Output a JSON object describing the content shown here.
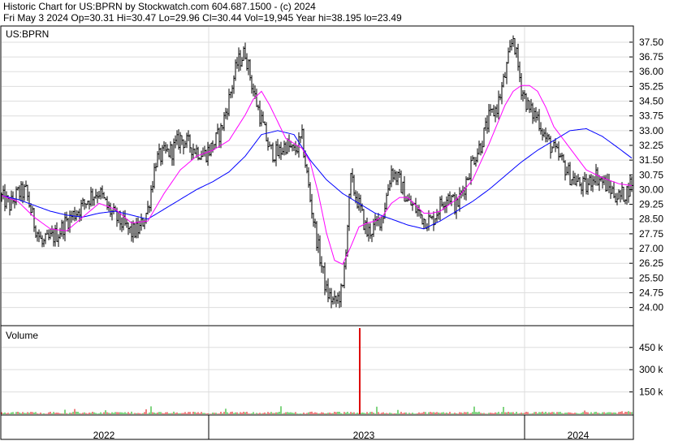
{
  "header": {
    "line1": "Historic Chart for US:BPRN by Stockwatch.com 604.687.1500 - (c) 2024",
    "line2": "Fri May  3 2024  Op=30.31  Hi=30.47  Lo=29.96  Cl=30.44  Vol=19,945  Year hi=38.195  lo=23.49"
  },
  "colors": {
    "price": "#000000",
    "ma_short": "#ff00ff",
    "ma_long": "#0000ff",
    "volume_up": "#00aa00",
    "volume_down": "#dd0000",
    "spike": "#dd0000"
  },
  "chart_data": [
    {
      "type": "line",
      "title": "US:BPRN",
      "xlabel": "",
      "ylabel": "",
      "x_ticks": [
        "2022",
        "2023",
        "2024"
      ],
      "ylim": [
        23.2,
        38.2
      ],
      "y_ticks": [
        "24.00",
        "24.75",
        "25.50",
        "26.25",
        "27.00",
        "27.75",
        "28.50",
        "29.25",
        "30.00",
        "30.75",
        "31.50",
        "32.25",
        "33.00",
        "33.75",
        "34.50",
        "35.25",
        "36.00",
        "36.75",
        "37.50"
      ],
      "grid": true,
      "series": [
        {
          "role": "price",
          "x": [
            0,
            10,
            20,
            30,
            40,
            50,
            60,
            70,
            80,
            90,
            100,
            110,
            120,
            130,
            140,
            150,
            160,
            170,
            180,
            190,
            200,
            210,
            220,
            230,
            240,
            250,
            260,
            270,
            280,
            290,
            300,
            310,
            320,
            330,
            340,
            350,
            360,
            370,
            380,
            390,
            400,
            410,
            420,
            430,
            440,
            450,
            460,
            470,
            480,
            490,
            500,
            510,
            520,
            530,
            540,
            550,
            560,
            570,
            580,
            590,
            600,
            610,
            620,
            630,
            640,
            650,
            660,
            670,
            680,
            690,
            700,
            710,
            720,
            730,
            740,
            750,
            760,
            770,
            776
          ],
          "values": [
            29.6,
            29.2,
            29.8,
            29.9,
            28.3,
            27.2,
            27.5,
            27.8,
            28.4,
            28.8,
            29.2,
            29.7,
            29.9,
            29.1,
            28.6,
            28.2,
            27.8,
            28.0,
            29.0,
            31.5,
            31.8,
            32.0,
            32.6,
            32.3,
            32.0,
            31.8,
            32.2,
            33.0,
            34.6,
            36.4,
            37.0,
            35.0,
            33.5,
            32.0,
            31.8,
            32.3,
            31.9,
            32.6,
            29.5,
            27.0,
            24.8,
            24.2,
            24.9,
            30.5,
            29.2,
            27.8,
            28.1,
            28.8,
            31.0,
            30.4,
            29.4,
            29.0,
            28.5,
            28.4,
            29.2,
            29.8,
            29.1,
            30.2,
            31.5,
            32.3,
            33.6,
            34.2,
            35.8,
            37.8,
            35.2,
            34.0,
            33.7,
            32.6,
            32.0,
            31.4,
            30.7,
            30.3,
            30.1,
            30.8,
            30.4,
            30.0,
            29.6,
            29.9,
            30.44
          ]
        },
        {
          "role": "ma_short",
          "x": [
            0,
            20,
            40,
            60,
            80,
            100,
            120,
            140,
            160,
            180,
            200,
            220,
            240,
            260,
            280,
            300,
            310,
            320,
            330,
            350,
            370,
            380,
            390,
            400,
            410,
            420,
            430,
            440,
            450,
            460,
            470,
            480,
            490,
            500,
            510,
            520,
            530,
            540,
            560,
            580,
            600,
            620,
            630,
            640,
            650,
            660,
            670,
            680,
            700,
            720,
            740,
            760,
            776
          ],
          "values": [
            29.7,
            29.4,
            28.6,
            28.0,
            27.9,
            28.6,
            29.3,
            29.0,
            28.3,
            28.4,
            29.8,
            31.0,
            31.7,
            32.0,
            32.5,
            33.8,
            34.6,
            35.0,
            34.3,
            32.6,
            32.1,
            31.4,
            29.8,
            27.8,
            26.4,
            26.2,
            27.1,
            28.1,
            28.3,
            28.4,
            28.7,
            29.3,
            29.6,
            29.6,
            29.2,
            28.8,
            28.8,
            28.9,
            29.5,
            30.5,
            32.3,
            34.3,
            35.0,
            35.3,
            35.3,
            35.0,
            34.2,
            33.2,
            32.1,
            31.0,
            30.6,
            30.3,
            30.2
          ]
        },
        {
          "role": "ma_long",
          "x": [
            0,
            20,
            40,
            60,
            80,
            100,
            120,
            140,
            160,
            180,
            200,
            220,
            240,
            260,
            280,
            300,
            320,
            340,
            360,
            380,
            400,
            420,
            440,
            460,
            480,
            500,
            520,
            540,
            560,
            580,
            600,
            620,
            640,
            660,
            680,
            700,
            720,
            740,
            760,
            776
          ],
          "values": [
            29.7,
            29.5,
            29.2,
            28.9,
            28.7,
            28.6,
            28.8,
            28.9,
            28.7,
            28.5,
            29.0,
            29.5,
            30.0,
            30.4,
            30.9,
            31.7,
            32.8,
            33.0,
            32.8,
            31.5,
            30.5,
            29.8,
            29.3,
            28.8,
            28.5,
            28.2,
            28.0,
            28.4,
            28.9,
            29.4,
            30.0,
            30.7,
            31.4,
            32.0,
            32.5,
            33.0,
            33.1,
            32.7,
            32.1,
            31.6
          ]
        }
      ]
    },
    {
      "type": "bar",
      "title": "Volume",
      "xlabel": "",
      "ylabel": "",
      "ylim": [
        0,
        580
      ],
      "y_ticks": [
        "150 k",
        "300 k",
        "450 k"
      ],
      "y_tick_values": [
        150,
        300,
        450
      ],
      "grid": true,
      "spike": {
        "x": 441,
        "value": 580
      }
    }
  ]
}
